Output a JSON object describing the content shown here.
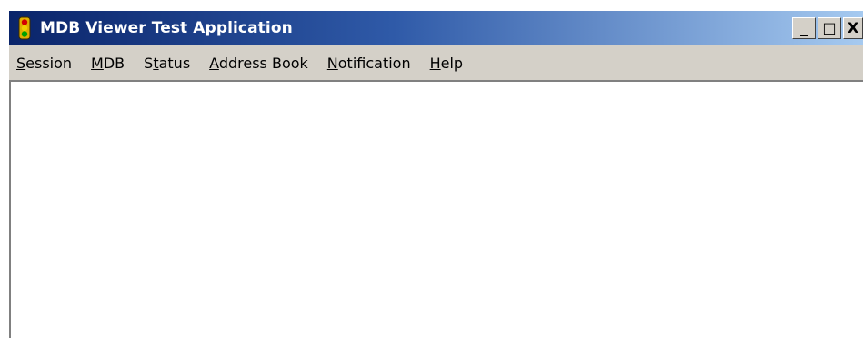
{
  "window": {
    "title": "MDB Viewer Test Application",
    "icon": "traffic-light-icon",
    "controls": {
      "minimize": "_",
      "maximize": "□",
      "close": "X"
    }
  },
  "menubar": {
    "items": [
      {
        "accel": "S",
        "rest": "ession"
      },
      {
        "accel": "M",
        "rest": "DB"
      },
      {
        "pre": "S",
        "accel": "t",
        "rest": "atus"
      },
      {
        "accel": "A",
        "rest": "ddress Book"
      },
      {
        "accel": "N",
        "rest": "otification"
      },
      {
        "accel": "H",
        "rest": "elp"
      }
    ]
  },
  "colors": {
    "titlebar_start": "#0a246a",
    "titlebar_end": "#a6caf0",
    "chrome": "#d4d0c8",
    "client": "#ffffff"
  }
}
